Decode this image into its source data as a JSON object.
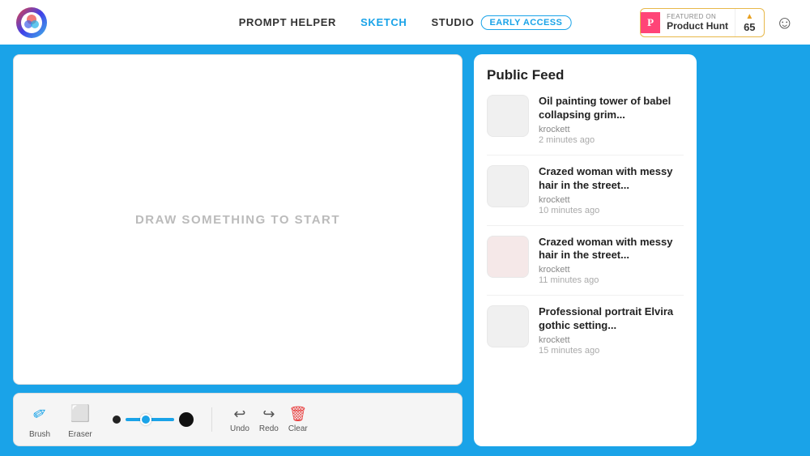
{
  "header": {
    "nav": [
      {
        "label": "PROMPT HELPER",
        "active": false
      },
      {
        "label": "SKETCH",
        "active": true
      },
      {
        "label": "STUDIO",
        "active": false
      }
    ],
    "early_access": "EARLY ACCESS",
    "product_hunt": {
      "featured_on": "FEATURED ON",
      "product": "Product Hunt",
      "count": "65"
    }
  },
  "canvas": {
    "placeholder": "DRAW SOMETHING TO START"
  },
  "toolbar": {
    "brush_label": "Brush",
    "eraser_label": "Eraser",
    "undo_label": "Undo",
    "redo_label": "Redo",
    "clear_label": "Clear"
  },
  "feed": {
    "title": "Public Feed",
    "items": [
      {
        "title": "Oil painting tower of babel collapsing grim...",
        "author": "krockett",
        "time": "2 minutes ago"
      },
      {
        "title": "Crazed woman with messy hair in the street...",
        "author": "krockett",
        "time": "10 minutes ago"
      },
      {
        "title": "Crazed woman with messy hair in the street...",
        "author": "krockett",
        "time": "11 minutes ago"
      },
      {
        "title": "Professional portrait Elvira gothic setting...",
        "author": "krockett",
        "time": "15 minutes ago"
      }
    ]
  }
}
